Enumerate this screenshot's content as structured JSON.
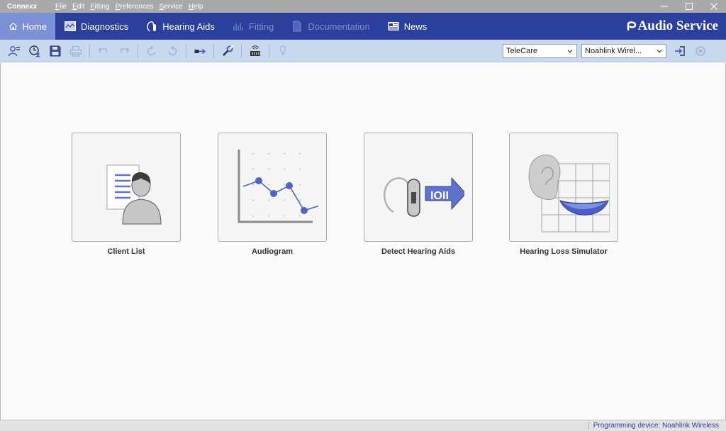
{
  "app": {
    "title": "Connexx"
  },
  "menu": [
    "File",
    "Edit",
    "Fitting",
    "Preferences",
    "Service",
    "Help"
  ],
  "nav": {
    "tabs": [
      {
        "label": "Home",
        "icon": "home-icon",
        "state": "active"
      },
      {
        "label": "Diagnostics",
        "icon": "diagnostics-icon",
        "state": "enabled"
      },
      {
        "label": "Hearing Aids",
        "icon": "hearing-aid-icon",
        "state": "enabled"
      },
      {
        "label": "Fitting",
        "icon": "fitting-icon",
        "state": "disabled"
      },
      {
        "label": "Documentation",
        "icon": "documentation-icon",
        "state": "disabled"
      },
      {
        "label": "News",
        "icon": "news-icon",
        "state": "enabled"
      }
    ],
    "brand": "Audio Service"
  },
  "toolbar": {
    "telecare_select": "TeleCare",
    "device_select": "Noahlink Wirel..."
  },
  "tiles": [
    {
      "label": "Client List",
      "icon": "client-list-icon"
    },
    {
      "label": "Audiogram",
      "icon": "audiogram-icon"
    },
    {
      "label": "Detect Hearing Aids",
      "icon": "detect-hearing-aids-icon"
    },
    {
      "label": "Hearing Loss Simulator",
      "icon": "hearing-loss-simulator-icon"
    }
  ],
  "status": {
    "text": "Programming device: Noahlink Wireless"
  },
  "colors": {
    "nav_bg": "#2b3f9c",
    "nav_active": "#7c90d8",
    "toolbar_bg": "#c8d8ee",
    "accent": "#4a5dc8"
  }
}
